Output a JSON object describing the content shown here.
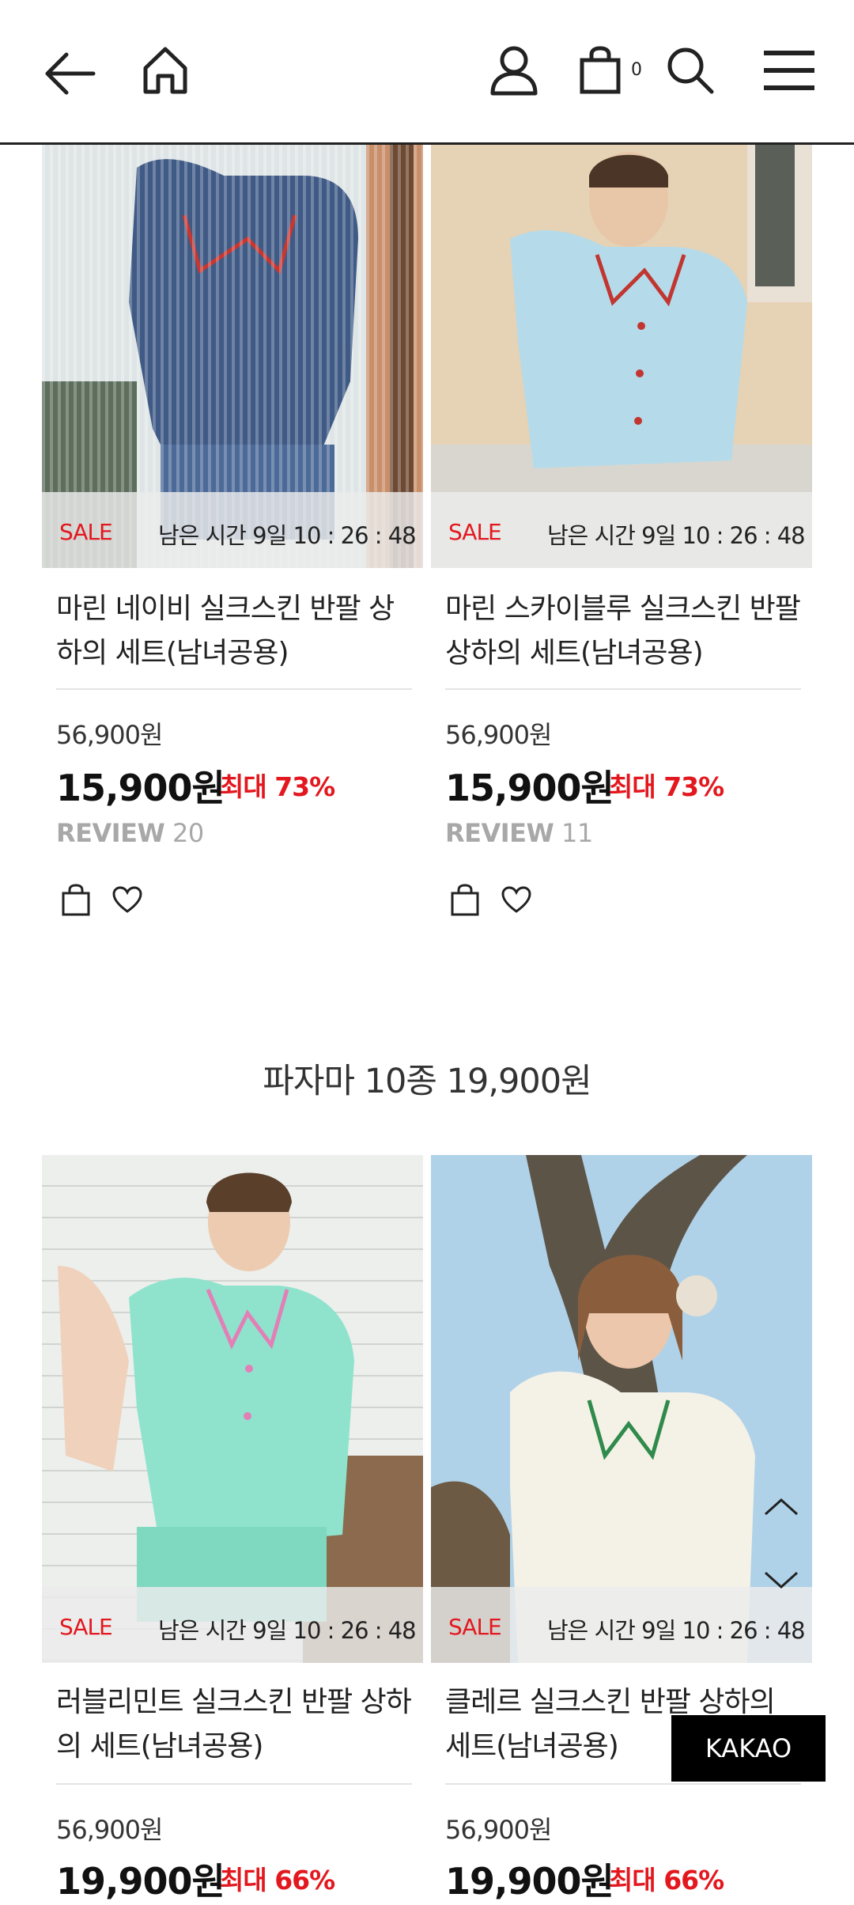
{
  "header": {
    "cart_count": "0",
    "icons": [
      "back-arrow-icon",
      "home-icon",
      "user-icon",
      "cart-bag-icon",
      "search-icon",
      "hamburger-menu-icon"
    ]
  },
  "section": {
    "title": "파자마 10종 19,900원"
  },
  "products": [
    {
      "sale_label": "SALE",
      "remaining": "남은 시간 9일 10 : 26 : 48",
      "name": "마린 네이비 실크스킨 반팔 상하의 세트(남녀공용)",
      "original_price": "56,900원",
      "sale_price": "15,900원",
      "discount": "최대 73%",
      "review_label": "REVIEW",
      "review_count": "20"
    },
    {
      "sale_label": "SALE",
      "remaining": "남은 시간 9일 10 : 26 : 48",
      "name": "마린 스카이블루 실크스킨 반팔 상하의 세트(남녀공용)",
      "original_price": "56,900원",
      "sale_price": "15,900원",
      "discount": "최대 73%",
      "review_label": "REVIEW",
      "review_count": "11"
    },
    {
      "sale_label": "SALE",
      "remaining": "남은 시간 9일 10 : 26 : 48",
      "name": "러블리민트 실크스킨 반팔 상하의 세트(남녀공용)",
      "original_price": "56,900원",
      "sale_price": "19,900원",
      "discount": "최대 66%"
    },
    {
      "sale_label": "SALE",
      "remaining": "남은 시간 9일 10 : 26 : 48",
      "name": "클레르 실크스킨 반팔 상하의 세트(남녀공용)",
      "original_price": "56,900원",
      "sale_price": "19,900원",
      "discount": "최대 66%"
    }
  ],
  "floating": {
    "kakao_label": "KAKAO"
  },
  "colors": {
    "accent_red": "#e3181f",
    "text_dark": "#222222",
    "review_gray": "#a8a8a8"
  }
}
